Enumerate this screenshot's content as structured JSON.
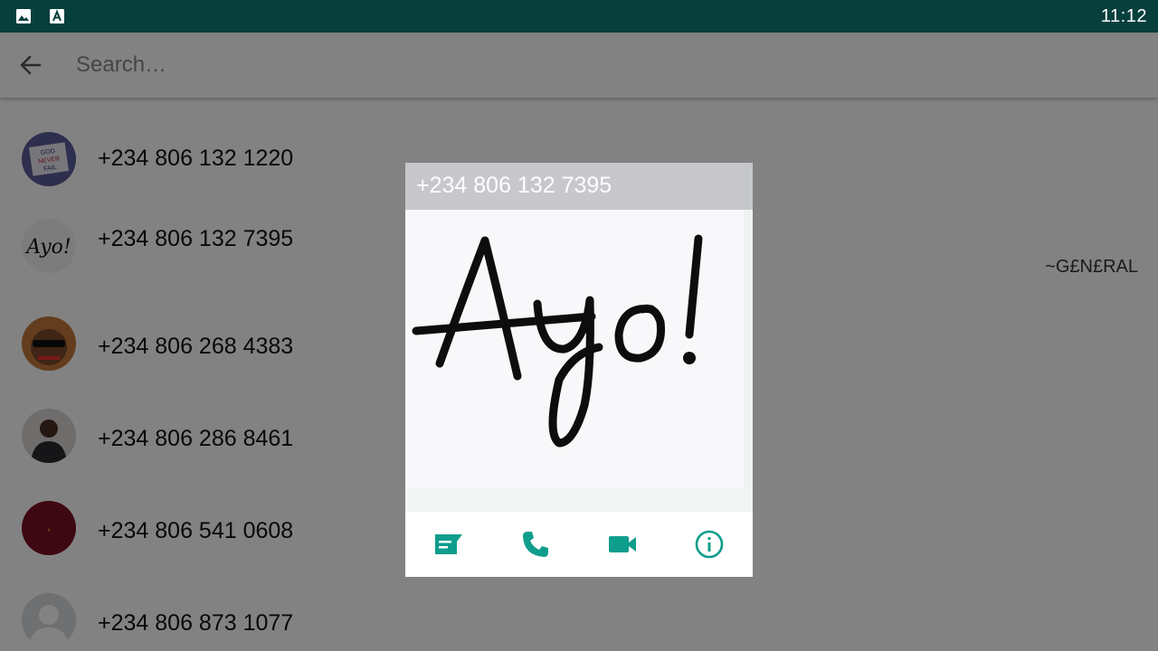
{
  "status_bar": {
    "time": "11:12",
    "icons": [
      "image-icon",
      "font-icon"
    ],
    "background": "#073f3d"
  },
  "search": {
    "placeholder": "Search…",
    "back_icon": "arrow-left-icon"
  },
  "contacts": [
    {
      "name": "+234 806 132 1220",
      "avatar": "photo-sign",
      "about": ""
    },
    {
      "name": "+234 806 132 7395",
      "avatar": "ayo-handwriting",
      "about": "~G£N£RAL"
    },
    {
      "name": "+234 806 268 4383",
      "avatar": "photo-person-sunglasses",
      "about": ""
    },
    {
      "name": "+234 806 286 8461",
      "avatar": "photo-person",
      "about": ""
    },
    {
      "name": "+234 806 541 0608",
      "avatar": "photo-dark-red",
      "about": ""
    },
    {
      "name": "+234 806 873 1077",
      "avatar": "default-person-icon",
      "about": ""
    }
  ],
  "profile_dialog": {
    "name": "+234 806 132 7395",
    "actions": [
      {
        "icon": "message-icon",
        "label": ""
      },
      {
        "icon": "phone-icon",
        "label": ""
      },
      {
        "icon": "video-camera-icon",
        "label": ""
      },
      {
        "icon": "info-icon",
        "label": ""
      }
    ],
    "accent": "#0f9d8c"
  },
  "colors": {
    "accent": "#0f9d8c",
    "status_bar": "#073f3d",
    "overlay": "rgba(0,0,0,0.49)"
  }
}
